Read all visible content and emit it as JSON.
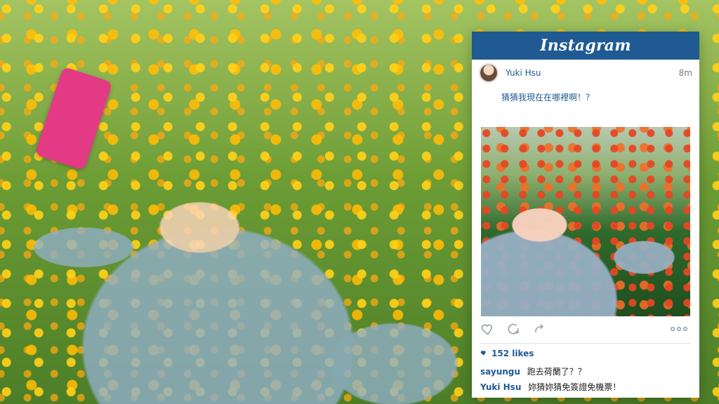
{
  "instagram": {
    "logo": "Instagram",
    "post": {
      "username": "Yuki Hsu",
      "time": "8m",
      "caption": "猜猜我現在在哪裡啊！？",
      "likes": "152 likes",
      "comments": [
        {
          "user": "sayungu",
          "text": "跑去荷蘭了？？"
        },
        {
          "user": "Yuki Hsu",
          "text": "妳猜妳猜免簽證免機票！"
        }
      ]
    },
    "icons": {
      "like": "heart-icon",
      "comment": "comment-icon",
      "share": "share-icon",
      "more": "more-icon",
      "likes_badge": "heart-icon"
    },
    "colors": {
      "header_bg": "#1f5a93",
      "accent_text": "#1f5a93"
    }
  }
}
